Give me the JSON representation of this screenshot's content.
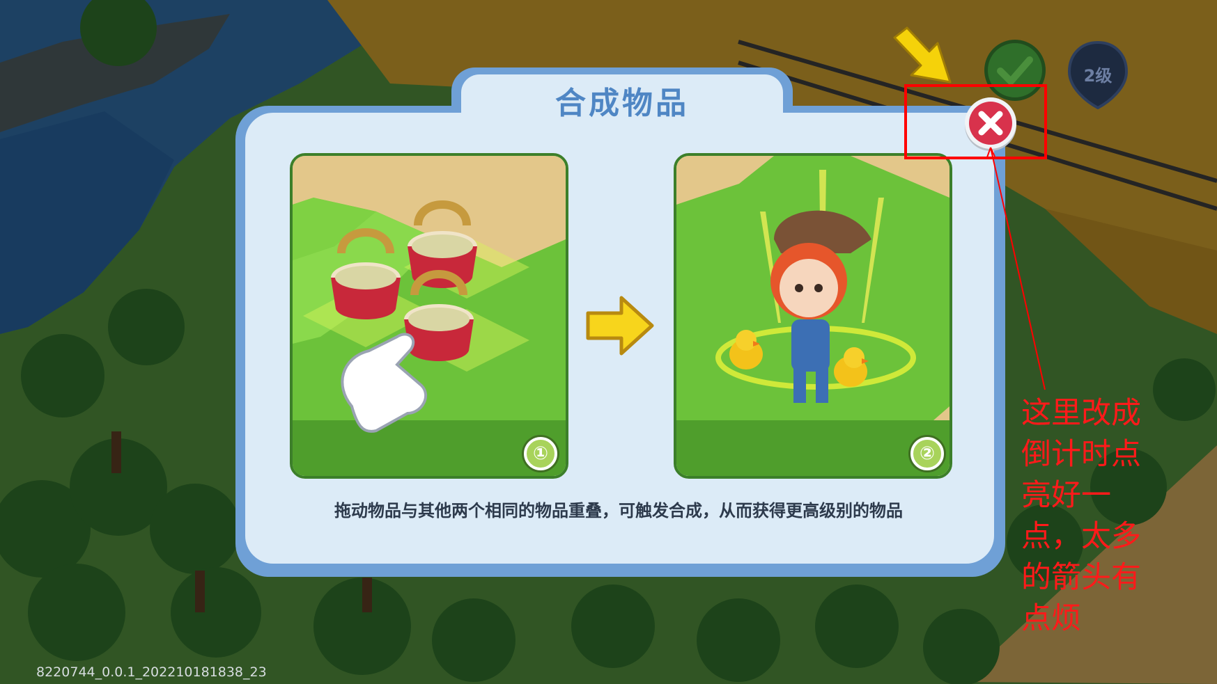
{
  "dialog": {
    "title": "合成物品",
    "description": "拖动物品与其他两个相同的物品重叠，可触发合成，从而获得更高级别的物品",
    "steps": [
      {
        "number": "①",
        "image": "merge-baskets-illustration"
      },
      {
        "number": "②",
        "image": "farmer-girl-reward-illustration"
      }
    ],
    "flow_icon": "right-arrow-icon",
    "close_icon": "close-icon"
  },
  "hud": {
    "confirm_icon": "checkmark-icon",
    "level_label": "2级"
  },
  "annotation": {
    "note": "这里改成倒计时点亮好一点，太多的箭头有点烦",
    "color": "#ff0000"
  },
  "footer": {
    "build_id": "8220744_0.0.1_202210181838_23"
  },
  "colors": {
    "dialog_border": "#6fa0d6",
    "dialog_bg": "#dcebf7",
    "title": "#4f86c4",
    "close_button": "#d8324c",
    "hint_arrow": "#f5d20a"
  }
}
